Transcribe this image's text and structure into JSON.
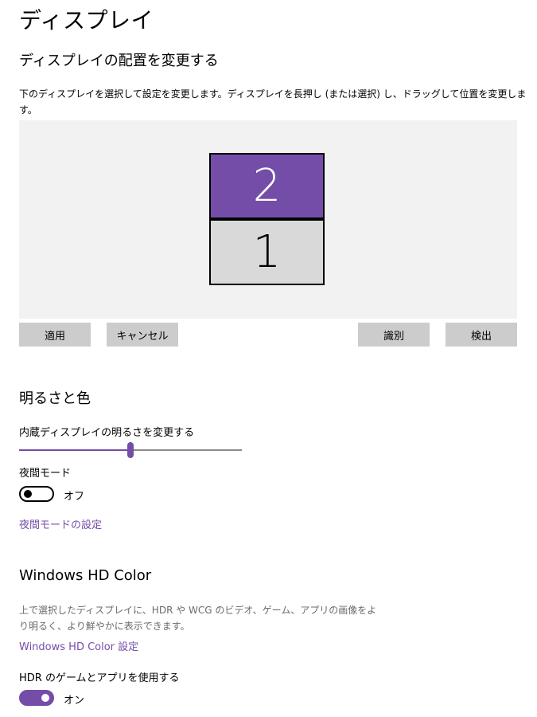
{
  "page_title": "ディスプレイ",
  "arrange": {
    "heading": "ディスプレイの配置を変更する",
    "description": "下のディスプレイを選択して設定を変更します。ディスプレイを長押し (または選択) し、ドラッグして位置を変更します。",
    "monitors": [
      {
        "number": "2",
        "selected": true
      },
      {
        "number": "1",
        "selected": false
      }
    ],
    "buttons": {
      "apply": "適用",
      "cancel": "キャンセル",
      "identify": "識別",
      "detect": "検出"
    }
  },
  "brightness": {
    "heading": "明るさと色",
    "slider_label": "内蔵ディスプレイの明るさを変更する",
    "slider_value_fraction": 0.5,
    "night_mode": {
      "label": "夜間モード",
      "state": "オフ",
      "on": false,
      "settings_link": "夜間モードの設定"
    }
  },
  "hd_color": {
    "heading": "Windows HD Color",
    "description": "上で選択したディスプレイに、HDR や WCG のビデオ、ゲーム、アプリの画像をより明るく、より鮮やかに表示できます。",
    "settings_link": "Windows HD Color 設定",
    "hdr": {
      "label": "HDR のゲームとアプリを使用する",
      "state": "オン",
      "on": true
    }
  },
  "colors": {
    "accent": "#744da9",
    "canvas_bg": "#f2f2f2",
    "button_bg": "#cccccc"
  }
}
